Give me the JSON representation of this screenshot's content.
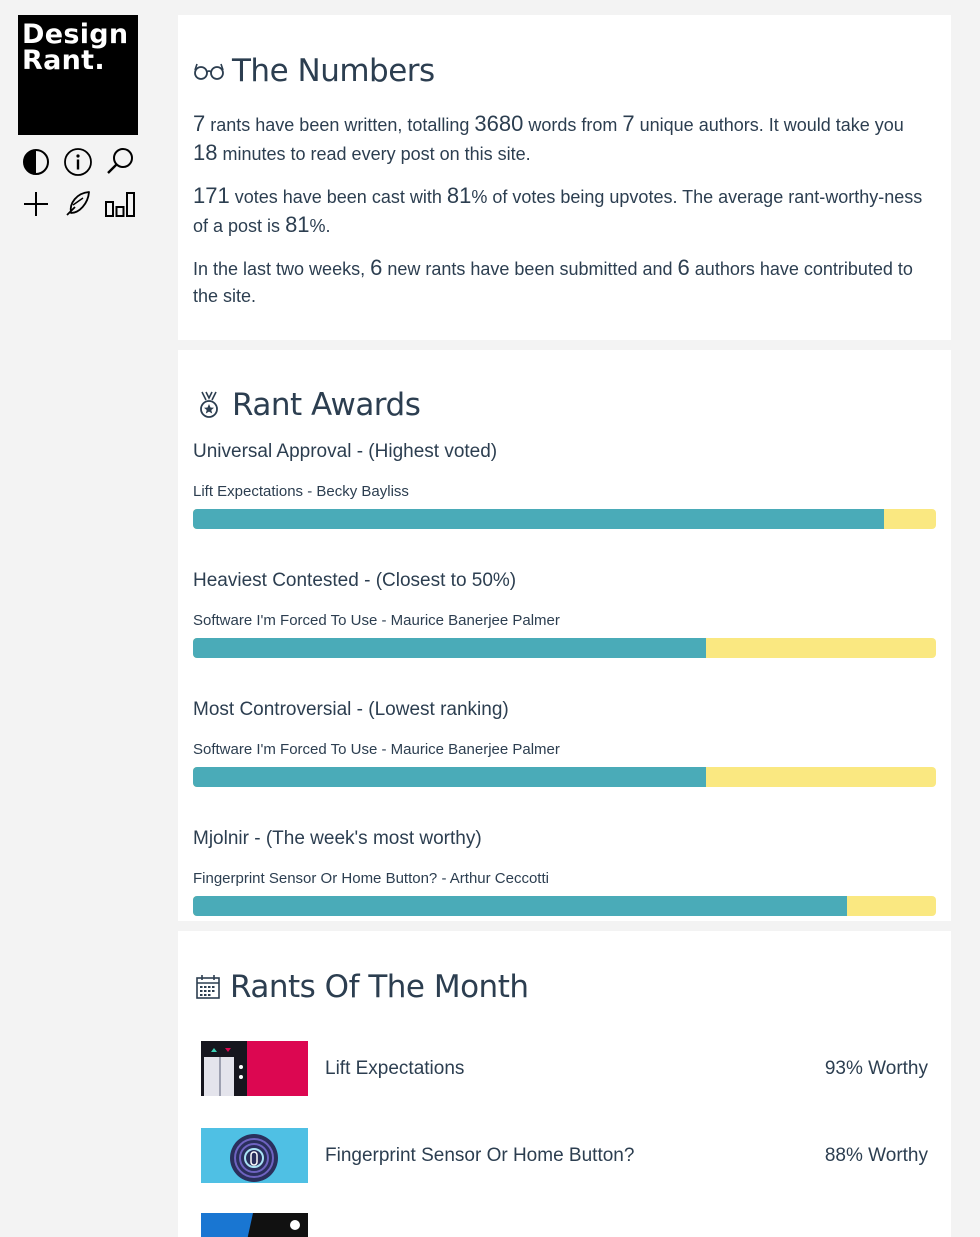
{
  "logo": {
    "line1": "Design",
    "line2": "Rant."
  },
  "toolbar": {
    "icons": [
      "contrast-icon",
      "info-icon",
      "search-icon",
      "plus-icon",
      "feather-icon",
      "chart-bars-icon"
    ]
  },
  "numbers": {
    "title": "The Numbers",
    "rants": "7",
    "rants_text": " rants have been written, totalling ",
    "words": "3680",
    "words_text": " words from ",
    "authors": "7",
    "authors_text": " unique authors. It would take you ",
    "minutes": "18",
    "minutes_text": " minutes to read every post on this site.",
    "votes": "171",
    "votes_text": " votes have been cast with ",
    "upvotes": "81",
    "upvotes_text": "% of votes being upvotes. The average rant-worthy-ness of a post is ",
    "worthiness": "81",
    "worthiness_text": "%.",
    "recent_intro": "In the last two weeks, ",
    "new_rants": "6",
    "new_rants_text": " new rants have been submitted and ",
    "new_authors": "6",
    "new_authors_text": " authors have contributed to the site."
  },
  "awards": {
    "title": "Rant Awards",
    "items": [
      {
        "title": "Universal Approval - (Highest voted)",
        "post": "Lift Expectations - Becky Bayliss",
        "upvote_fraction": 0.93
      },
      {
        "title": "Heaviest Contested - (Closest to 50%)",
        "post": "Software I'm Forced To Use - Maurice Banerjee Palmer",
        "upvote_fraction": 0.69
      },
      {
        "title": "Most Controversial - (Lowest ranking)",
        "post": "Software I'm Forced To Use - Maurice Banerjee Palmer",
        "upvote_fraction": 0.69
      },
      {
        "title": "Mjolnir - (The week's most worthy)",
        "post": "Fingerprint Sensor Or Home Button? - Arthur Ceccotti",
        "upvote_fraction": 0.88
      }
    ]
  },
  "month": {
    "title": "Rants Of The Month",
    "items": [
      {
        "title": "Lift Expectations",
        "worthy": "93% Worthy"
      },
      {
        "title": "Fingerprint Sensor Or Home Button?",
        "worthy": "88% Worthy"
      }
    ]
  },
  "colors": {
    "upvote": "#4aabb8",
    "downvote": "#fae881",
    "text": "#2c3e50",
    "logo_bg": "#000000"
  }
}
